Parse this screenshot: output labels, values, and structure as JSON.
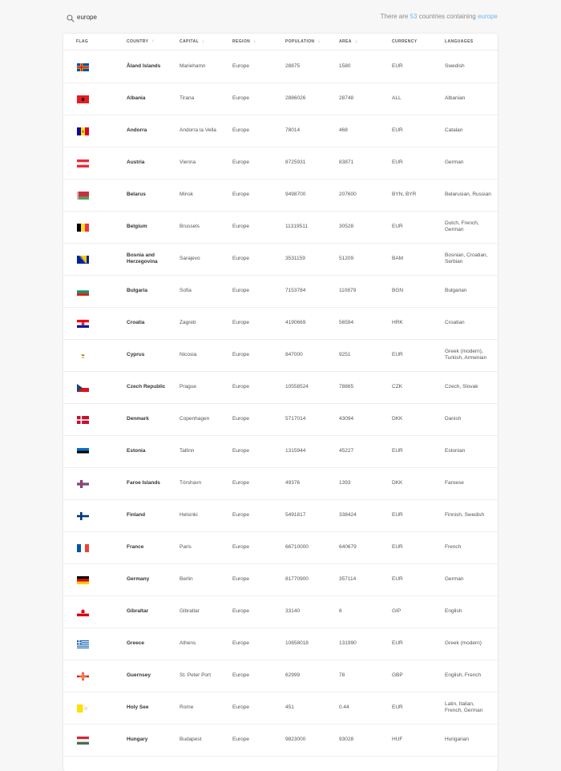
{
  "search": {
    "value": "europe"
  },
  "summary": {
    "prefix": "There are",
    "count": "53",
    "middle": "countries containing",
    "term": "europe"
  },
  "table": {
    "headers": [
      "FLAG",
      "COUNTRY",
      "CAPITAL",
      "REGION",
      "POPULATION",
      "AREA",
      "CURRENCY",
      "LANGUAGES"
    ],
    "rows": [
      {
        "flag": "aland-flag-icon",
        "country": "Åland Islands",
        "capital": "Mariehamn",
        "region": "Europe",
        "population": "28875",
        "area": "1580",
        "currency": "EUR",
        "languages": "Swedish"
      },
      {
        "flag": "albania-flag-icon",
        "country": "Albania",
        "capital": "Tirana",
        "region": "Europe",
        "population": "2886026",
        "area": "28748",
        "currency": "ALL",
        "languages": "Albanian"
      },
      {
        "flag": "andorra-flag-icon",
        "country": "Andorra",
        "capital": "Andorra la Vella",
        "region": "Europe",
        "population": "78014",
        "area": "468",
        "currency": "EUR",
        "languages": "Catalan"
      },
      {
        "flag": "austria-flag-icon",
        "country": "Austria",
        "capital": "Vienna",
        "region": "Europe",
        "population": "8725931",
        "area": "83871",
        "currency": "EUR",
        "languages": "German"
      },
      {
        "flag": "belarus-flag-icon",
        "country": "Belarus",
        "capital": "Minsk",
        "region": "Europe",
        "population": "9498700",
        "area": "207600",
        "currency": "BYN, BYR",
        "languages": "Belarusian, Russian"
      },
      {
        "flag": "belgium-flag-icon",
        "country": "Belgium",
        "capital": "Brussels",
        "region": "Europe",
        "population": "11319511",
        "area": "30528",
        "currency": "EUR",
        "languages": "Dutch, French, German"
      },
      {
        "flag": "bosnia-flag-icon",
        "country": "Bosnia and Herzegovina",
        "capital": "Sarajevo",
        "region": "Europe",
        "population": "3531159",
        "area": "51209",
        "currency": "BAM",
        "languages": "Bosnian, Croatian, Serbian"
      },
      {
        "flag": "bulgaria-flag-icon",
        "country": "Bulgaria",
        "capital": "Sofia",
        "region": "Europe",
        "population": "7153784",
        "area": "110879",
        "currency": "BGN",
        "languages": "Bulgarian"
      },
      {
        "flag": "croatia-flag-icon",
        "country": "Croatia",
        "capital": "Zagreb",
        "region": "Europe",
        "population": "4190669",
        "area": "56594",
        "currency": "HRK",
        "languages": "Croatian"
      },
      {
        "flag": "cyprus-flag-icon",
        "country": "Cyprus",
        "capital": "Nicosia",
        "region": "Europe",
        "population": "847000",
        "area": "9251",
        "currency": "EUR",
        "languages": "Greek (modern), Turkish, Armenian"
      },
      {
        "flag": "czech-flag-icon",
        "country": "Czech Republic",
        "capital": "Prague",
        "region": "Europe",
        "population": "10558524",
        "area": "78865",
        "currency": "CZK",
        "languages": "Czech, Slovak"
      },
      {
        "flag": "denmark-flag-icon",
        "country": "Denmark",
        "capital": "Copenhagen",
        "region": "Europe",
        "population": "5717014",
        "area": "43094",
        "currency": "DKK",
        "languages": "Danish"
      },
      {
        "flag": "estonia-flag-icon",
        "country": "Estonia",
        "capital": "Tallinn",
        "region": "Europe",
        "population": "1315944",
        "area": "45227",
        "currency": "EUR",
        "languages": "Estonian"
      },
      {
        "flag": "faroe-flag-icon",
        "country": "Faroe Islands",
        "capital": "Tórshavn",
        "region": "Europe",
        "population": "49376",
        "area": "1393",
        "currency": "DKK",
        "languages": "Faroese"
      },
      {
        "flag": "finland-flag-icon",
        "country": "Finland",
        "capital": "Helsinki",
        "region": "Europe",
        "population": "5491817",
        "area": "338424",
        "currency": "EUR",
        "languages": "Finnish, Swedish"
      },
      {
        "flag": "france-flag-icon",
        "country": "France",
        "capital": "Paris",
        "region": "Europe",
        "population": "66710000",
        "area": "640679",
        "currency": "EUR",
        "languages": "French"
      },
      {
        "flag": "germany-flag-icon",
        "country": "Germany",
        "capital": "Berlin",
        "region": "Europe",
        "population": "81770900",
        "area": "357114",
        "currency": "EUR",
        "languages": "German"
      },
      {
        "flag": "gibraltar-flag-icon",
        "country": "Gibraltar",
        "capital": "Gibraltar",
        "region": "Europe",
        "population": "33140",
        "area": "6",
        "currency": "GIP",
        "languages": "English"
      },
      {
        "flag": "greece-flag-icon",
        "country": "Greece",
        "capital": "Athens",
        "region": "Europe",
        "population": "10858018",
        "area": "131990",
        "currency": "EUR",
        "languages": "Greek (modern)"
      },
      {
        "flag": "guernsey-flag-icon",
        "country": "Guernsey",
        "capital": "St. Peter Port",
        "region": "Europe",
        "population": "62999",
        "area": "78",
        "currency": "GBP",
        "languages": "English, French"
      },
      {
        "flag": "holysee-flag-icon",
        "country": "Holy See",
        "capital": "Rome",
        "region": "Europe",
        "population": "451",
        "area": "0.44",
        "currency": "EUR",
        "languages": "Latin, Italian, French, German"
      },
      {
        "flag": "hungary-flag-icon",
        "country": "Hungary",
        "capital": "Budapest",
        "region": "Europe",
        "population": "9823000",
        "area": "93028",
        "currency": "HUF",
        "languages": "Hungarian"
      }
    ]
  }
}
